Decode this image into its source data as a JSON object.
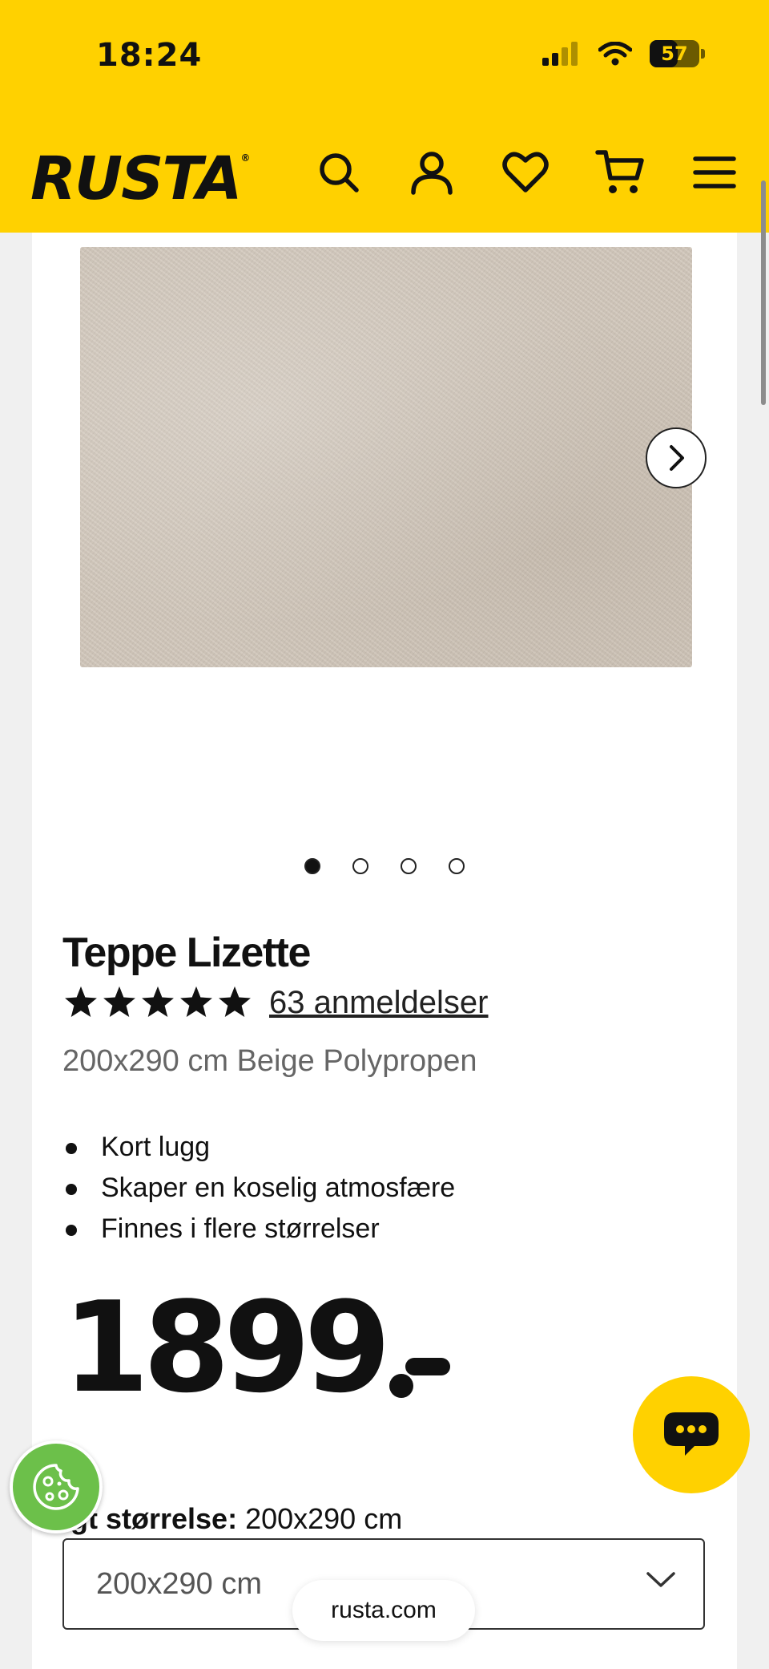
{
  "status_bar": {
    "time": "18:24",
    "battery": "57",
    "battery_level": 0.57
  },
  "header": {
    "logo": "RUSTA",
    "logo_mark": "®",
    "icons": [
      "search-icon",
      "account-icon",
      "heart-icon",
      "cart-icon",
      "menu-icon"
    ],
    "background_color": "#ffd100"
  },
  "gallery": {
    "image_alt": "Teppe Lizette beige rug",
    "image_count": 4,
    "active_index": 0,
    "next_icon": "chevron-right-icon"
  },
  "product": {
    "title": "Teppe Lizette",
    "rating": 5,
    "rating_max": 5,
    "reviews_label": "63 anmeldelser",
    "subtitle": "200x290 cm Beige Polypropen",
    "features": [
      "Kort lugg",
      "Skaper en koselig atmosfære",
      "Finnes i flere størrelser"
    ],
    "price": "1899",
    "size_label": "lgt størrelse:",
    "size_value": "200x290 cm",
    "size_select": "200x290 cm"
  },
  "floating": {
    "chat_icon": "chat-icon",
    "cookie_icon": "cookie-icon",
    "url": "rusta.com"
  }
}
